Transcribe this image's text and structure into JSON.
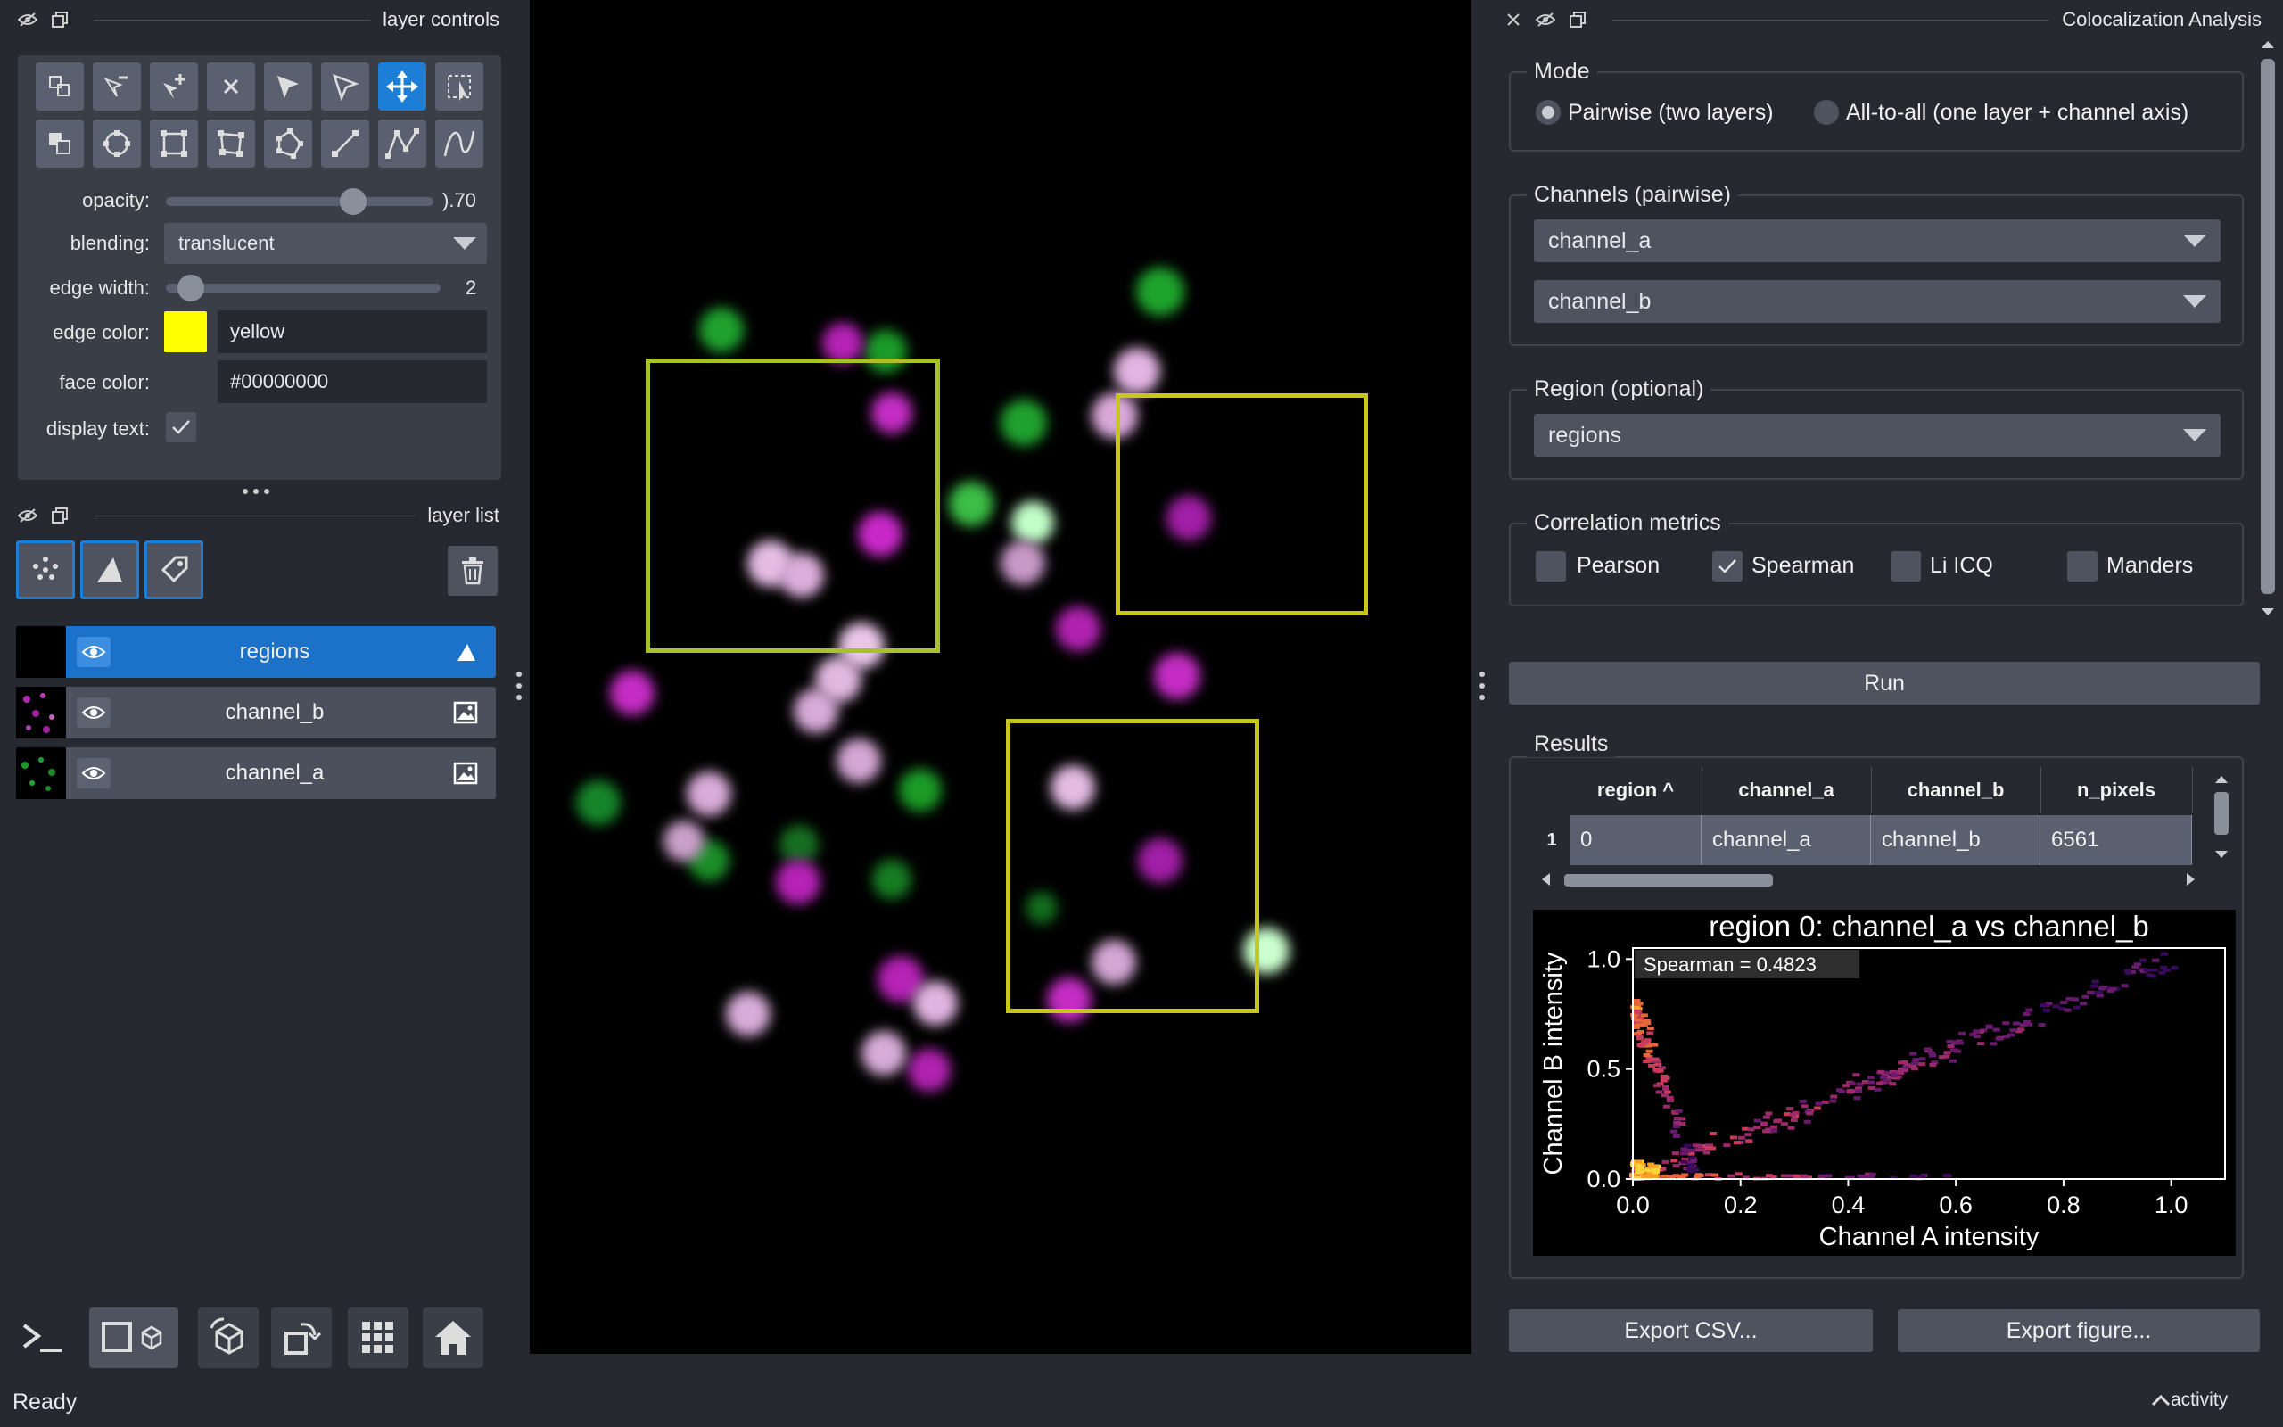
{
  "layer_controls": {
    "title": "layer controls",
    "opacity_label": "opacity:",
    "opacity_value": "0.70",
    "opacity_display": ").70",
    "opacity_fraction": 0.7,
    "blending_label": "blending:",
    "blending_value": "translucent",
    "edge_width_label": "edge width:",
    "edge_width_value": "2",
    "edge_color_label": "edge color:",
    "edge_color_value": "yellow",
    "edge_color_swatch": "#ffff00",
    "face_color_label": "face color:",
    "face_color_value": "#00000000",
    "display_text_label": "display text:",
    "display_text_checked": true,
    "tools_row1": [
      "vertex-insert-icon",
      "select-vertices-icon",
      "add-vertex-icon",
      "delete-shape-icon",
      "select-shape-icon",
      "direct-select-icon",
      "pan-zoom-icon",
      "transform-icon"
    ],
    "tools_row2": [
      "move-back-icon",
      "ellipse-icon",
      "rectangle-icon",
      "rectangle-rotate-icon",
      "polygon-icon",
      "line-icon",
      "path-icon",
      "polyline-icon"
    ],
    "active_tool": "pan-zoom-icon"
  },
  "layer_list": {
    "title": "layer list",
    "layers": [
      {
        "name": "regions",
        "type": "shapes",
        "selected": true
      },
      {
        "name": "channel_b",
        "type": "image",
        "selected": false
      },
      {
        "name": "channel_a",
        "type": "image",
        "selected": false
      }
    ]
  },
  "bottom_toolbar": [
    "console-icon",
    "2d-3d-toggle-icon",
    "roll-dims-icon",
    "transpose-icon",
    "grid-icon",
    "home-icon"
  ],
  "status": {
    "text": "Ready",
    "activity": "activity"
  },
  "plugin": {
    "title": "Colocalization Analysis",
    "mode": {
      "title": "Mode",
      "options": [
        "Pairwise (two layers)",
        "All-to-all (one layer + channel axis)"
      ],
      "selected": 0
    },
    "channels": {
      "title": "Channels (pairwise)",
      "a": "channel_a",
      "b": "channel_b"
    },
    "region": {
      "title": "Region (optional)",
      "value": "regions"
    },
    "metrics": {
      "title": "Correlation metrics",
      "items": [
        {
          "label": "Pearson",
          "checked": false
        },
        {
          "label": "Spearman",
          "checked": true
        },
        {
          "label": "Li ICQ",
          "checked": false
        },
        {
          "label": "Manders",
          "checked": false
        }
      ]
    },
    "run_label": "Run",
    "results": {
      "title": "Results",
      "columns": [
        "region ^",
        "channel_a",
        "channel_b",
        "n_pixels"
      ],
      "rows": [
        {
          "index": "1",
          "cells": [
            "0",
            "channel_a",
            "channel_b",
            "6561"
          ]
        }
      ]
    },
    "export_csv_label": "Export CSV...",
    "export_figure_label": "Export figure..."
  },
  "chart_data": {
    "type": "heatmap",
    "title": "region 0: channel_a vs channel_b",
    "xlabel": "Channel A intensity",
    "ylabel": "Channel B intensity",
    "xlim": [
      0,
      1.1
    ],
    "ylim": [
      0,
      1.05
    ],
    "xticks": [
      "0.0",
      "0.2",
      "0.4",
      "0.6",
      "0.8",
      "1.0"
    ],
    "yticks": [
      "0.0",
      "0.5",
      "1.0"
    ],
    "annotation": "Spearman = 0.4823",
    "colormap": "inferno",
    "density_ridges": [
      {
        "from": [
          0.0,
          0.0
        ],
        "to": [
          1.0,
          1.0
        ]
      },
      {
        "from": [
          0.0,
          0.8
        ],
        "to": [
          0.12,
          0.0
        ]
      },
      {
        "from": [
          0.0,
          0.0
        ],
        "to": [
          0.6,
          0.0
        ]
      }
    ]
  }
}
